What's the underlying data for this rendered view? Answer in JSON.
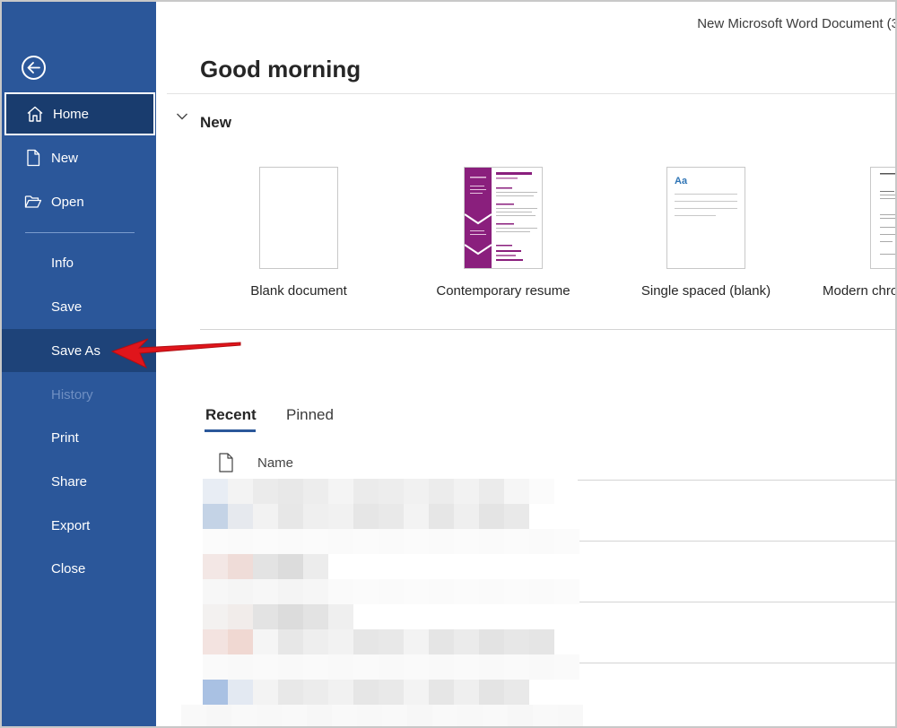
{
  "window": {
    "document_title": "New Microsoft Word Document (3"
  },
  "sidebar": {
    "back_icon": "back-arrow-icon",
    "items": [
      {
        "id": "home",
        "label": "Home",
        "icon": "home-icon",
        "state": "selected"
      },
      {
        "id": "new",
        "label": "New",
        "icon": "new-document-icon",
        "state": "normal"
      },
      {
        "id": "open",
        "label": "Open",
        "icon": "folder-open-icon",
        "state": "normal"
      },
      {
        "id": "info",
        "label": "Info",
        "state": "normal"
      },
      {
        "id": "save",
        "label": "Save",
        "state": "normal"
      },
      {
        "id": "save-as",
        "label": "Save As",
        "state": "highlighted"
      },
      {
        "id": "history",
        "label": "History",
        "state": "disabled"
      },
      {
        "id": "print",
        "label": "Print",
        "state": "normal"
      },
      {
        "id": "share",
        "label": "Share",
        "state": "normal"
      },
      {
        "id": "export",
        "label": "Export",
        "state": "normal"
      },
      {
        "id": "close",
        "label": "Close",
        "state": "normal"
      }
    ]
  },
  "main": {
    "greeting": "Good morning",
    "new_section": {
      "label": "New",
      "templates": [
        {
          "label": "Blank document"
        },
        {
          "label": "Contemporary resume"
        },
        {
          "label": "Single spaced (blank)",
          "thumb_text": "Aa"
        },
        {
          "label": "Modern chro"
        }
      ]
    },
    "tabs": [
      {
        "label": "Recent",
        "active": true
      },
      {
        "label": "Pinned",
        "active": false
      }
    ],
    "file_list": {
      "name_header": "Name"
    }
  },
  "colors": {
    "sidebar_bg": "#2b579a",
    "selected_bg": "#193c6e",
    "highlight_bg": "#1e4379",
    "annotation_arrow": "#e0151b",
    "resume_accent": "#8a1f7d"
  }
}
